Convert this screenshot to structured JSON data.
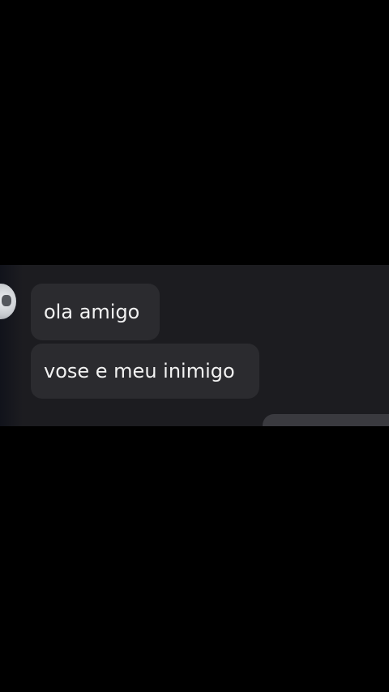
{
  "messages": [
    {
      "sender": "other",
      "text": "ola amigo"
    },
    {
      "sender": "other",
      "text": "vose e meu inimigo"
    }
  ],
  "colors": {
    "background": "#000000",
    "chat_background": "#1c1c20",
    "incoming_bubble": "#2b2b2f",
    "outgoing_bubble": "#3a3a3f",
    "text": "#f2f2f2"
  },
  "icons": {
    "avatar": "contact-avatar"
  }
}
